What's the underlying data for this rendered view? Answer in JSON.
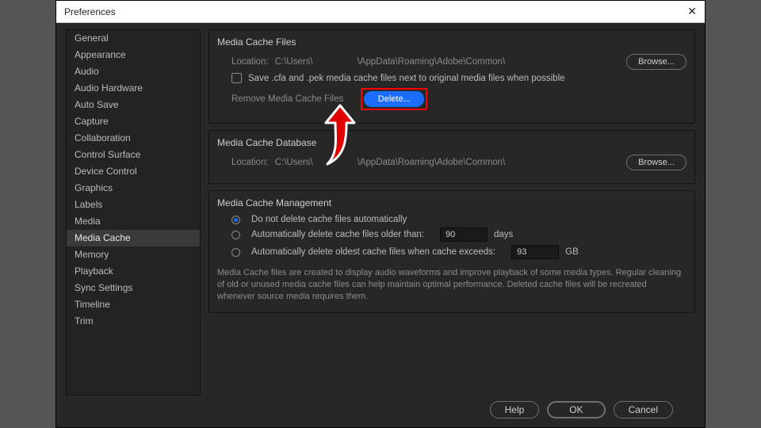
{
  "window": {
    "title": "Preferences"
  },
  "sidebar": {
    "items": [
      "General",
      "Appearance",
      "Audio",
      "Audio Hardware",
      "Auto Save",
      "Capture",
      "Collaboration",
      "Control Surface",
      "Device Control",
      "Graphics",
      "Labels",
      "Media",
      "Media Cache",
      "Memory",
      "Playback",
      "Sync Settings",
      "Timeline",
      "Trim"
    ],
    "selected_index": 12
  },
  "cache_files": {
    "title": "Media Cache Files",
    "location_label": "Location:",
    "location_prefix": "C:\\Users\\",
    "location_suffix": "\\AppData\\Roaming\\Adobe\\Common\\",
    "browse": "Browse...",
    "save_next": "Save .cfa and .pek media cache files next to original media files when possible",
    "remove_label": "Remove Media Cache Files",
    "delete": "Delete..."
  },
  "cache_db": {
    "title": "Media Cache Database",
    "location_label": "Location:",
    "location_prefix": "C:\\Users\\",
    "location_suffix": "\\AppData\\Roaming\\Adobe\\Common\\",
    "browse": "Browse..."
  },
  "mgmt": {
    "title": "Media Cache Management",
    "opt1": "Do not delete cache files automatically",
    "opt2": "Automatically delete cache files older than:",
    "opt3": "Automatically delete oldest cache files when cache exceeds:",
    "days_value": "90",
    "days_unit": "days",
    "gb_value": "93",
    "gb_unit": "GB",
    "selected": 0,
    "note": "Media Cache files are created to display audio waveforms and improve playback of some media types.  Regular cleaning of old or unused media cache files can help maintain optimal performance. Deleted cache files will be recreated whenever source media requires them."
  },
  "footer": {
    "help": "Help",
    "ok": "OK",
    "cancel": "Cancel"
  }
}
